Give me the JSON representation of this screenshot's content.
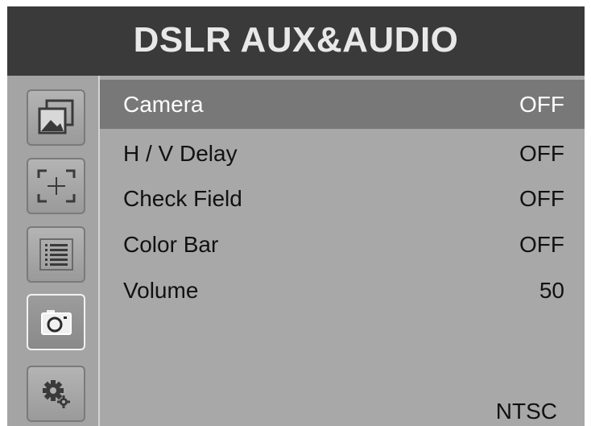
{
  "header": {
    "title": "DSLR AUX&AUDIO"
  },
  "sidebar": {
    "items": [
      {
        "icon": "picture-icon"
      },
      {
        "icon": "crosshair-frame-icon"
      },
      {
        "icon": "list-icon"
      },
      {
        "icon": "camera-icon",
        "active": true
      },
      {
        "icon": "settings-gears-icon"
      }
    ]
  },
  "menu": {
    "items": [
      {
        "label": "Camera",
        "value": "OFF",
        "selected": true
      },
      {
        "label": "H / V Delay",
        "value": "OFF"
      },
      {
        "label": "Check Field",
        "value": "OFF"
      },
      {
        "label": "Color Bar",
        "value": "OFF"
      },
      {
        "label": "Volume",
        "value": "50"
      }
    ]
  },
  "footer": {
    "signal": "NTSC"
  },
  "colors": {
    "header_bg": "#3a3a3a",
    "panel_bg": "#a8a8a8",
    "selected_row_bg": "#787878",
    "active_tile_border": "#f2f2f2"
  }
}
